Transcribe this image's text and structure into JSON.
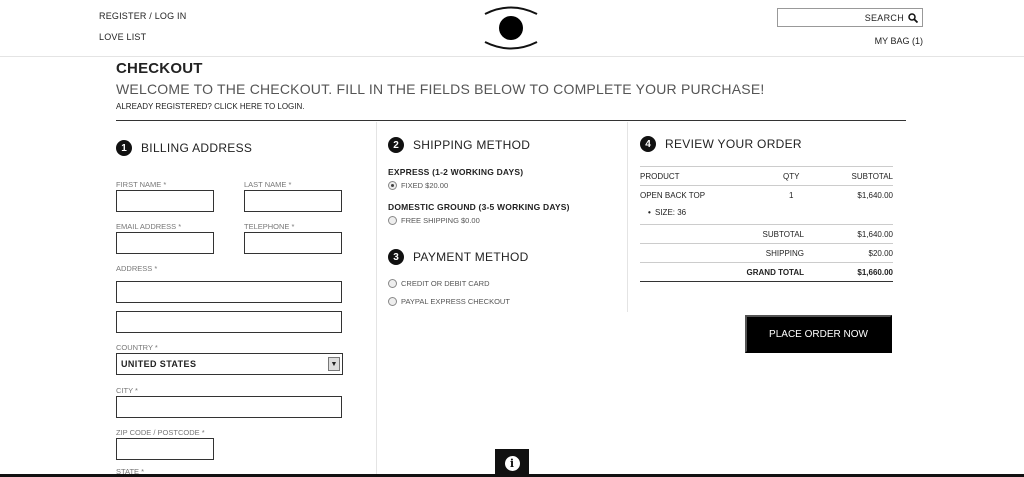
{
  "header": {
    "register_login": "REGISTER / LOG IN",
    "love_list": "LOVE LIST",
    "search_label": "SEARCH",
    "my_bag": "MY BAG (1)",
    "logo_icon": "eye-logo-icon"
  },
  "checkout": {
    "title": "CHECKOUT",
    "welcome": "WELCOME TO THE CHECKOUT. FILL IN THE FIELDS BELOW TO COMPLETE YOUR PURCHASE!",
    "login_hint": "ALREADY REGISTERED? CLICK HERE TO LOGIN."
  },
  "billing": {
    "step": "1",
    "title": "BILLING ADDRESS",
    "first_name_label": "FIRST NAME *",
    "last_name_label": "LAST NAME *",
    "email_label": "EMAIL ADDRESS *",
    "telephone_label": "TELEPHONE *",
    "address_label": "ADDRESS *",
    "country_label": "COUNTRY *",
    "country_value": "UNITED STATES",
    "city_label": "CITY *",
    "zip_label": "ZIP CODE / POSTCODE *",
    "state_label": "STATE *"
  },
  "shipping": {
    "step": "2",
    "title": "SHIPPING METHOD",
    "options": [
      {
        "title": "EXPRESS (1-2 WORKING DAYS)",
        "label": "FIXED $20.00",
        "selected": true
      },
      {
        "title": "DOMESTIC GROUND (3-5 WORKING DAYS)",
        "label": "FREE SHIPPING $0.00",
        "selected": false
      }
    ]
  },
  "payment": {
    "step": "3",
    "title": "PAYMENT METHOD",
    "options": [
      {
        "label": "CREDIT OR DEBIT CARD",
        "selected": false
      },
      {
        "label": "PAYPAL EXPRESS CHECKOUT",
        "selected": false
      }
    ]
  },
  "review": {
    "step": "4",
    "title": "REVIEW YOUR ORDER",
    "columns": [
      "PRODUCT",
      "QTY",
      "SUBTOTAL"
    ],
    "item": {
      "name": "OPEN BACK TOP",
      "qty": "1",
      "subtotal": "$1,640.00",
      "option": "SIZE: 36"
    },
    "subtotal_label": "SUBTOTAL",
    "subtotal_value": "$1,640.00",
    "shipping_label": "SHIPPING",
    "shipping_value": "$20.00",
    "grand_total_label": "GRAND TOTAL",
    "grand_total_value": "$1,660.00",
    "place_order": "PLACE ORDER NOW"
  },
  "colors": {
    "accent": "#000000",
    "rule": "#333333",
    "divider": "#e4e4e4"
  }
}
